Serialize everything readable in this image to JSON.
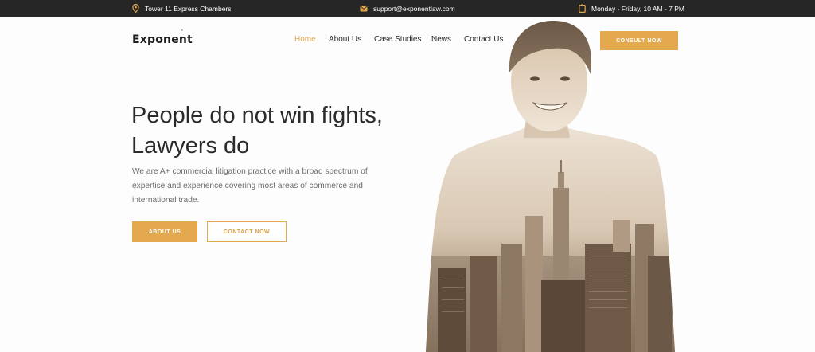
{
  "topbar": {
    "address": "Tower 11 Express Chambers",
    "email": "support@exponentlaw.com",
    "hours": "Monday - Friday, 10 AM - 7 PM"
  },
  "header": {
    "logo": "Exponent",
    "nav": [
      "Home",
      "About Us",
      "Case Studies",
      "News",
      "Contact Us"
    ],
    "active_nav": "Home",
    "cta": "CONSULT NOW"
  },
  "hero": {
    "headline_line1": "People do not win fights,",
    "headline_line2": "Lawyers do",
    "paragraph_line1": "We are A+ commercial litigation practice with a broad spectrum of",
    "paragraph_line2": "expertise and experience covering most areas of commerce and",
    "paragraph_line3": "international trade.",
    "primary_button": "ABOUT US",
    "secondary_button": "CONTACT NOW"
  },
  "colors": {
    "accent": "#e4a94e",
    "topbar": "#262626",
    "sepia_dark": "#5b4a3a",
    "sepia_light": "#e9dccb"
  }
}
